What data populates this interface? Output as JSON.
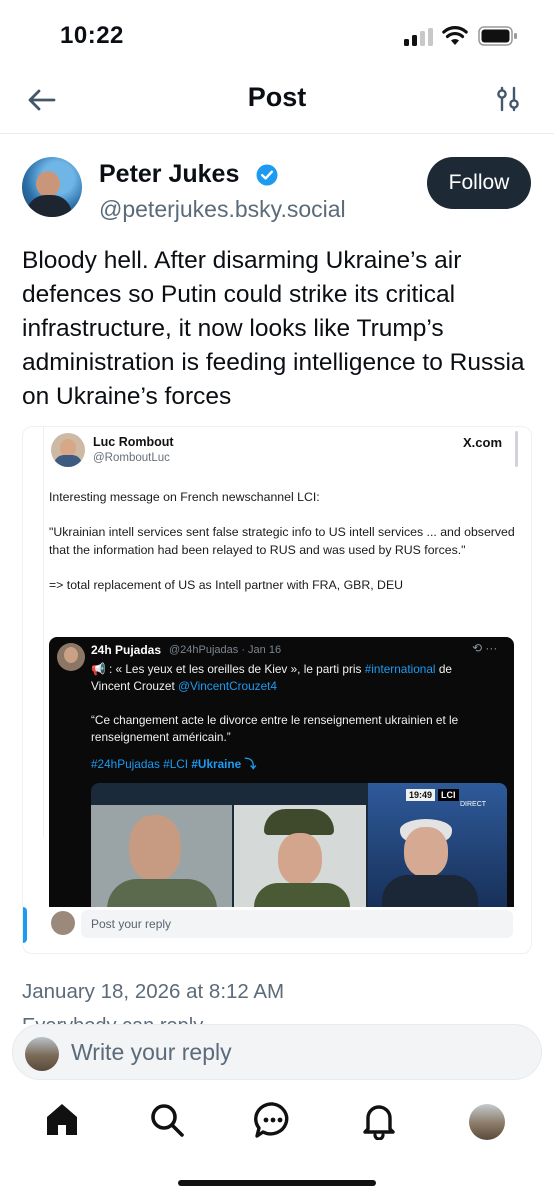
{
  "status_bar": {
    "time": "10:22"
  },
  "header": {
    "title": "Post"
  },
  "author": {
    "name": "Peter Jukes",
    "handle": "@peterjukes.bsky.social",
    "follow_label": "Follow"
  },
  "post": {
    "text": "Bloody hell. After disarming Ukraine’s air defences so Putin could strike its critical infrastructure, it now looks like Trump’s administration is feeding intelligence to Russia on Ukraine’s forces",
    "date": "January 18, 2026 at 8:12 AM",
    "cut_text": "Everybody can reply"
  },
  "embed": {
    "name": "Luc Rombout",
    "handle": "@RomboutLuc",
    "source": "X.com",
    "text": "Interesting message on French newschannel LCI:\n\n\"Ukrainian intell services sent false strategic info to US intell services ... and observed that the information had been relayed to RUS and was used by RUS forces.\"\n\n=> total replacement of US as Intell partner with FRA, GBR, DEU",
    "quoted": {
      "name": "24h Pujadas",
      "meta": "@24hPujadas · Jan 16",
      "icons": "⟲ ···",
      "line1_prefix": "📢 : « Les yeux et les oreilles de Kiev », le parti pris ",
      "line1_link": "#international",
      "line1_suffix": " de",
      "line2_prefix": "Vincent Crouzet ",
      "line2_link": "@VincentCrouzet4",
      "quote": "“Ce changement acte le divorce entre le renseignement ukrainien et le renseignement américain.”",
      "tags": "#24hPujadas #LCI",
      "tag_bold": "#Ukraine ⤵",
      "lci_time": "19:49",
      "lci_logo": "LCI",
      "lci_direct": "DIRECT"
    },
    "reply_placeholder": "Post your reply"
  },
  "composer": {
    "placeholder": "Write your reply"
  },
  "colors": {
    "accent": "#1d9bf0",
    "follow_bg": "#1e2936",
    "muted": "#5c6b7a"
  },
  "icons": [
    "back-arrow-icon",
    "filter-icon",
    "verified-icon",
    "home-icon",
    "search-icon",
    "chat-icon",
    "bell-icon"
  ]
}
